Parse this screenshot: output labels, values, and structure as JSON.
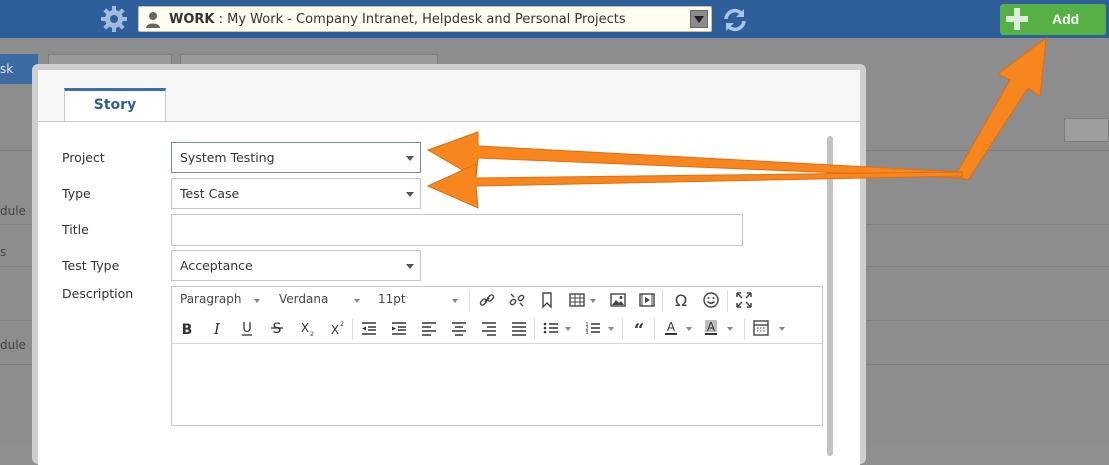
{
  "topbar": {
    "workspace_prefix": "WORK",
    "workspace_separator": " : ",
    "workspace_name": "My Work - Company Intranet, Helpdesk and Personal Projects",
    "add_label": "Add",
    "icons": [
      "gear-icon",
      "user-icon",
      "chevron-down-icon",
      "refresh-icon",
      "plus-icon"
    ]
  },
  "background": {
    "button_label": "sk",
    "row_labels": [
      "dule",
      "s",
      "dule"
    ]
  },
  "modal": {
    "tab_label": "Story",
    "fields": {
      "project": {
        "label": "Project",
        "value": "System Testing"
      },
      "type": {
        "label": "Type",
        "value": "Test Case"
      },
      "title": {
        "label": "Title",
        "value": ""
      },
      "test_type": {
        "label": "Test Type",
        "value": "Acceptance"
      },
      "description": {
        "label": "Description"
      }
    },
    "editor": {
      "format": "Paragraph",
      "font": "Verdana",
      "size": "11pt"
    }
  },
  "colors": {
    "topbar": "#2f5f9b",
    "add_button": "#55b144",
    "arrow": "#f7861e",
    "tab_accent": "#3d6fa8"
  }
}
